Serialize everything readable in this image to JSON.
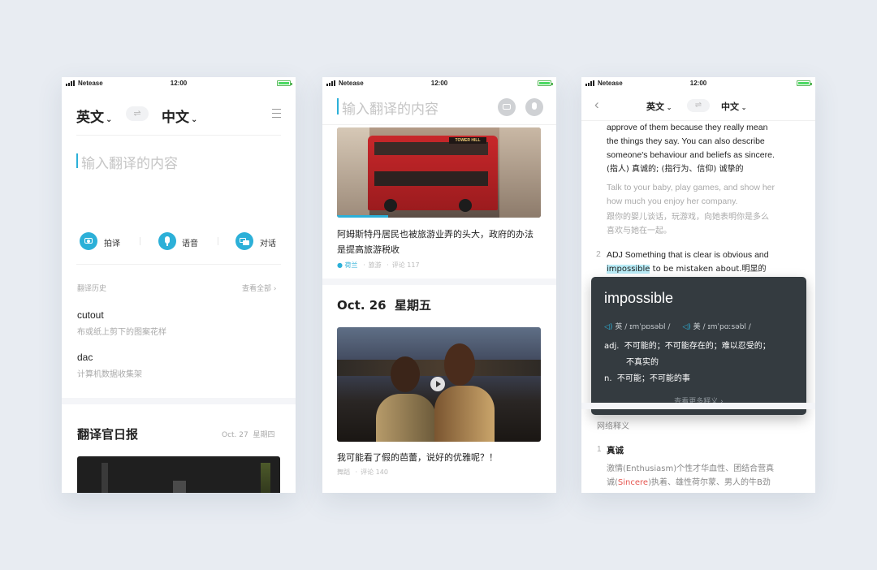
{
  "status": {
    "carrier": "Netease",
    "time": "12:00"
  },
  "colors": {
    "accent": "#2cb0d8",
    "highlight": "#b9ecf7",
    "popup_bg": "#343b40",
    "red_word": "#e5554f"
  },
  "screen1": {
    "lang_from": "英文",
    "lang_to": "中文",
    "input_placeholder": "输入翻译的内容",
    "actions": [
      {
        "label": "拍译",
        "icon": "camera-icon"
      },
      {
        "label": "语音",
        "icon": "mic-icon"
      },
      {
        "label": "对话",
        "icon": "chat-icon"
      }
    ],
    "history_title": "翻译历史",
    "view_all": "查看全部 ›",
    "history": [
      {
        "word": "cutout",
        "meaning": "布或纸上剪下的图案花样"
      },
      {
        "word": "dac",
        "meaning": "计算机数据收集架"
      }
    ],
    "daily_title": "翻译官日报",
    "daily_date": "Oct. 27  星期四"
  },
  "screen2": {
    "input_placeholder": "输入翻译的内容",
    "bus_sign": "TOWER HILL",
    "article1": {
      "title": "阿姆斯特丹居民也被旅游业弄的头大，政府的办法是提高旅游税收",
      "location": "荷兰",
      "category": "旅游",
      "comments": "评论 117"
    },
    "date_header": "Oct. 26  星期五",
    "article2": {
      "title": "我可能看了假的芭蕾，说好的优雅呢？！",
      "category": "舞蹈",
      "comments": "评论 140"
    }
  },
  "screen3": {
    "lang_from": "英文",
    "lang_to": "中文",
    "def_lines": [
      "approve of them because they really mean",
      "the things they say. You can also describe",
      "someone's behaviour and beliefs as sincere.",
      "(指人) 真诚的; (指行为、信仰) 诚挚的"
    ],
    "example_en": [
      "Talk to your baby, play games, and show her",
      "how much you enjoy her company."
    ],
    "example_cn": [
      "跟你的婴儿谈话，玩游戏，向她表明你是多么",
      "喜欢与她在一起。"
    ],
    "def2_num": "2",
    "def2_line1": "ADJ Something that is clear is obvious and",
    "def2_word": "impossible",
    "def2_rest": " to be mistaken about.明显的",
    "popup": {
      "word": "impossible",
      "uk_label": "英",
      "uk_ipa": "/ ɪmˈpɒsəbl /",
      "us_label": "美",
      "us_ipa": "/ ɪmˈpɑːsəbl /",
      "adj_pos": "adj.",
      "adj_line1": "不可能的；不可能存在的；难以忍受的；",
      "adj_line2": "不真实的",
      "n_pos": "n.",
      "n_line": "不可能；不可能的事",
      "more": "查看更多释义 ›"
    },
    "web_title": "网络释义",
    "web1_num": "1",
    "web1_word": "真诚",
    "web1_line1": "激情(Enthusiasm)个性才华血性、团结合营真",
    "web1_line2_pre": "诚(",
    "web1_line2_red": "Sincere",
    "web1_line2_post": ")执着、雄性荷尔蒙、男人的牛B劲"
  }
}
